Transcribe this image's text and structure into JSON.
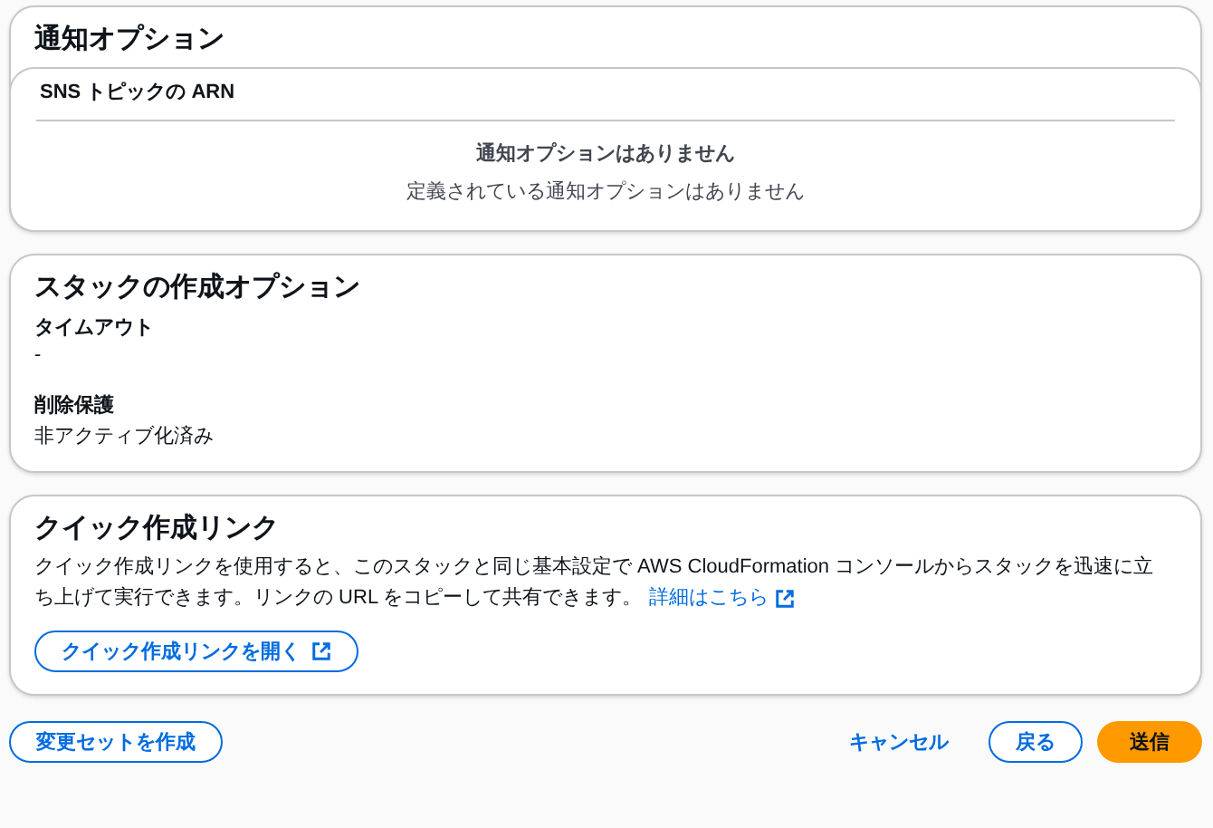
{
  "notifications": {
    "title": "通知オプション",
    "column_header": "SNS トピックの ARN",
    "empty_title": "通知オプションはありません",
    "empty_description": "定義されている通知オプションはありません"
  },
  "stack_options": {
    "title": "スタックの作成オプション",
    "fields": [
      {
        "label": "タイムアウト",
        "value": "-"
      },
      {
        "label": "削除保護",
        "value": "非アクティブ化済み"
      }
    ]
  },
  "quick_link": {
    "title": "クイック作成リンク",
    "description": "クイック作成リンクを使用すると、このスタックと同じ基本設定で AWS CloudFormation コンソールからスタックを迅速に立ち上げて実行できます。リンクの URL をコピーして共有できます。",
    "link": "詳細はこちら",
    "button": "クイック作成リンクを開く"
  },
  "footer": {
    "buttons": [
      {
        "label": "変更セットを作成",
        "kind": "secondary"
      },
      {
        "label": "キャンセル",
        "kind": "link"
      },
      {
        "label": "戻る",
        "kind": "secondary"
      },
      {
        "label": "送信",
        "kind": "primary"
      }
    ]
  }
}
